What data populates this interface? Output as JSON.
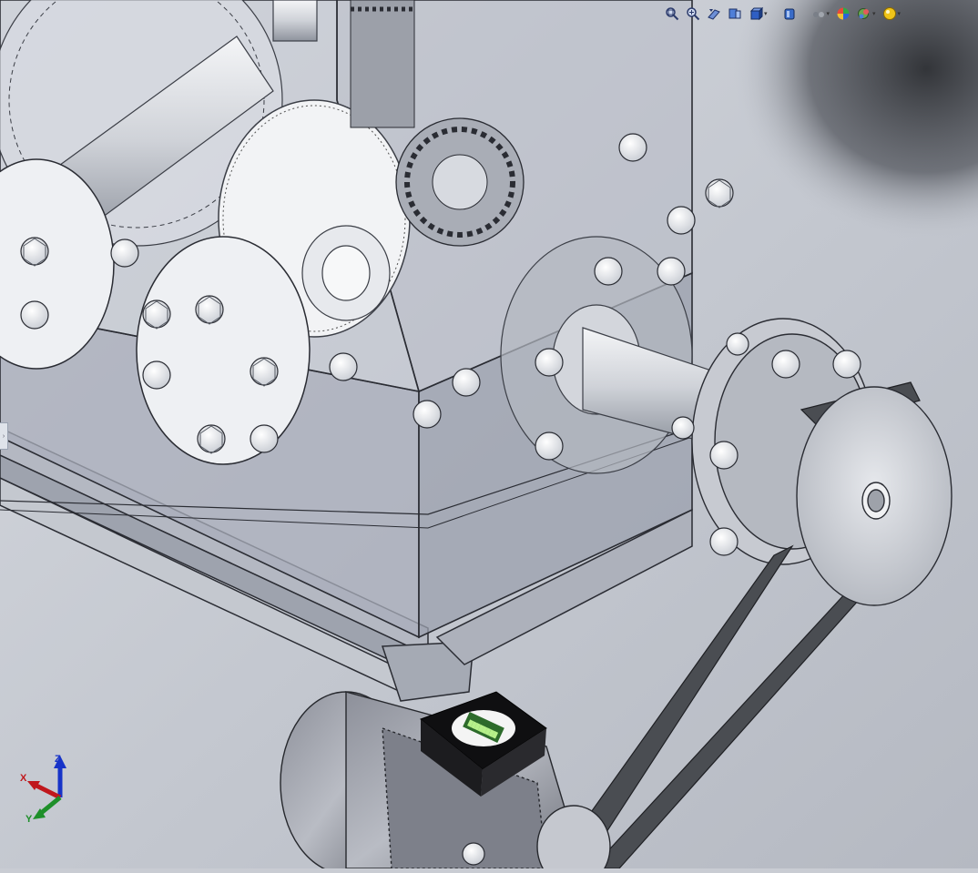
{
  "toolbar": {
    "items": [
      {
        "name": "zoom-to-fit",
        "icon": "zoom-fit-icon"
      },
      {
        "name": "zoom-to-area",
        "icon": "zoom-area-icon"
      },
      {
        "name": "previous-view",
        "icon": "previous-view-icon"
      },
      {
        "name": "section-view",
        "icon": "section-view-icon"
      },
      {
        "name": "view-orientation",
        "icon": "view-orientation-icon",
        "dropdown": true
      },
      {
        "name": "display-style",
        "icon": "display-style-icon",
        "dropdown": true
      },
      {
        "name": "hide-show-items",
        "icon": "hide-show-icon",
        "dropdown": true
      },
      {
        "name": "edit-appearance",
        "icon": "appearance-icon"
      },
      {
        "name": "apply-scene",
        "icon": "scene-icon",
        "dropdown": true
      },
      {
        "name": "view-settings",
        "icon": "view-settings-icon",
        "dropdown": true
      }
    ]
  },
  "triad": {
    "x_label": "X",
    "y_label": "Y",
    "z_label": "Z",
    "colors": {
      "x": "#c0171c",
      "y": "#1e8f2a",
      "z": "#1733c8"
    }
  },
  "motor": {
    "nameplate_text": "████████"
  },
  "colors": {
    "background": "#c9ccd3",
    "housing": "#a9aebb",
    "housing_line": "#2a2c33",
    "metal_light": "#e9ebef",
    "metal_mid": "#b7bbc5",
    "belt": "#4a4d52"
  }
}
